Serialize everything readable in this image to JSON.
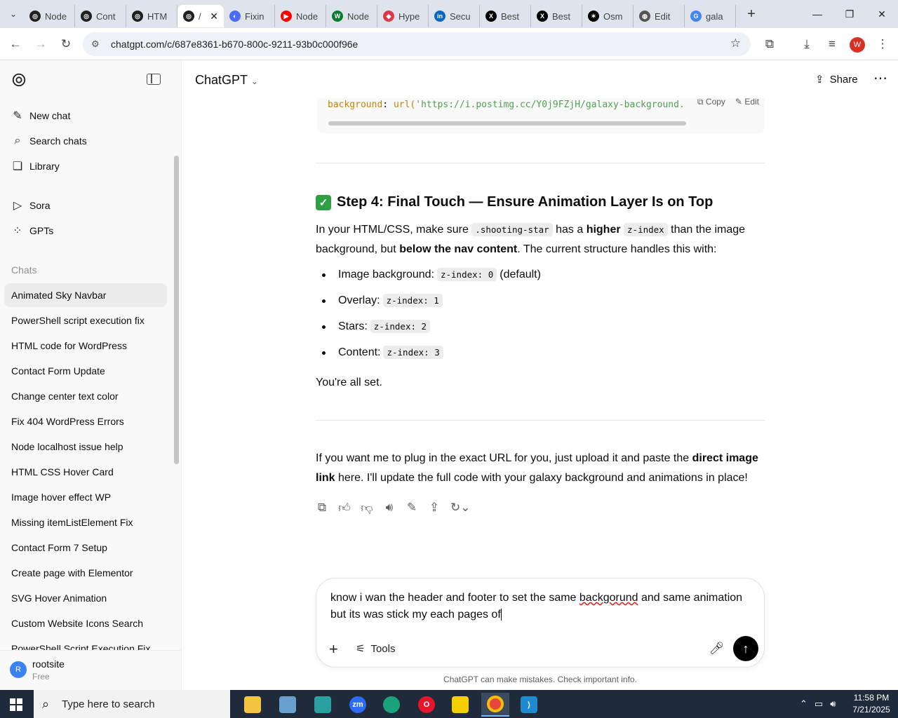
{
  "browser": {
    "tabs": [
      {
        "label": "Node",
        "color": "#202020",
        "glyph": "◎"
      },
      {
        "label": "Cont",
        "color": "#202020",
        "glyph": "◎"
      },
      {
        "label": "HTM",
        "color": "#202020",
        "glyph": "◎"
      },
      {
        "label": "/",
        "color": "#202020",
        "glyph": "◎",
        "active": true
      },
      {
        "label": "Fixin",
        "color": "#4a6cf7",
        "glyph": "◐"
      },
      {
        "label": "Node",
        "color": "#ff0000",
        "glyph": "▶"
      },
      {
        "label": "Node",
        "color": "#0a7a2f",
        "glyph": "W"
      },
      {
        "label": "Hype",
        "color": "#d93a4a",
        "glyph": "◆"
      },
      {
        "label": "Secu",
        "color": "#0a66c2",
        "glyph": "in"
      },
      {
        "label": "Best",
        "color": "#000000",
        "glyph": "X"
      },
      {
        "label": "Best",
        "color": "#000000",
        "glyph": "X"
      },
      {
        "label": "Osm",
        "color": "#000000",
        "glyph": "✶"
      },
      {
        "label": "Edit",
        "color": "#555555",
        "glyph": "◍"
      },
      {
        "label": "gala",
        "color": "#4285f4",
        "glyph": "G"
      }
    ],
    "url": "chatgpt.com/c/687e8361-b670-800c-9211-93b0c000f96e",
    "profile_initial": "W"
  },
  "sidebar": {
    "nav": [
      {
        "label": "New chat",
        "icon": "✎"
      },
      {
        "label": "Search chats",
        "icon": "⌕"
      },
      {
        "label": "Library",
        "icon": "❏"
      }
    ],
    "nav2": [
      {
        "label": "Sora",
        "icon": "▷"
      },
      {
        "label": "GPTs",
        "icon": "⁘"
      }
    ],
    "section_label": "Chats",
    "chats": [
      "Animated Sky Navbar",
      "PowerShell script execution fix",
      "HTML code for WordPress",
      "Contact Form Update",
      "Change center text color",
      "Fix 404 WordPress Errors",
      "Node localhost issue help",
      "HTML CSS Hover Card",
      "Image hover effect WP",
      "Missing itemListElement Fix",
      "Contact Form 7 Setup",
      "Create page with Elementor",
      "SVG Hover Animation",
      "Custom Website Icons Search",
      "PowerShell Script Execution Fix"
    ],
    "user": {
      "initial": "R",
      "name": "rootsite",
      "plan": "Free"
    }
  },
  "header": {
    "model": "ChatGPT",
    "share_label": "Share"
  },
  "message": {
    "code_prop": "background",
    "code_fn": "url(",
    "code_str": "'https://i.postimg.cc/Y0j9FZjH/galaxy-background.",
    "copy_label": "Copy",
    "edit_label": "Edit",
    "step_title": "Step 4: Final Touch — Ensure Animation Layer Is on Top",
    "para1_a": "In your HTML/CSS, make sure ",
    "para1_code1": ".shooting-star",
    "para1_b": " has a ",
    "para1_bold1": "higher",
    "para1_code2": "z-index",
    "para1_c": " than the image background, but ",
    "para1_bold2": "below the nav content",
    "para1_d": ". The current structure handles this with:",
    "bullets": [
      {
        "label": "Image background:",
        "code": "z-index: 0",
        "suffix": "(default)"
      },
      {
        "label": "Overlay:",
        "code": "z-index: 1",
        "suffix": ""
      },
      {
        "label": "Stars:",
        "code": "z-index: 2",
        "suffix": ""
      },
      {
        "label": "Content:",
        "code": "z-index: 3",
        "suffix": ""
      }
    ],
    "closing": "You're all set.",
    "para2_a": "If you want me to plug in the exact URL for you, just upload it and paste the ",
    "para2_bold": "direct image link",
    "para2_b": " here. I'll update the full code with your galaxy background and animations in place!"
  },
  "composer": {
    "text_a": "know i wan the header and footer to set the  same ",
    "text_typo": "backgorund",
    "text_b": " and same animation but its was stick my each pages of ",
    "tools_label": "Tools"
  },
  "disclaimer": "ChatGPT can make mistakes. Check important info.",
  "taskbar": {
    "search_placeholder": "Type here to search",
    "time": "11:58 PM",
    "date": "7/21/2025"
  }
}
